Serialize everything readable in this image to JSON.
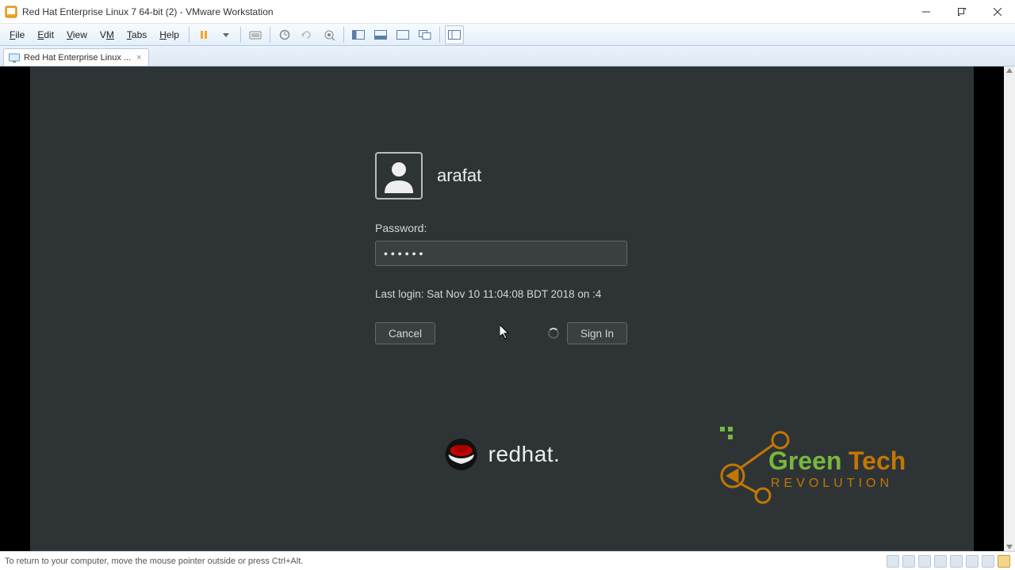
{
  "window": {
    "title": "Red Hat Enterprise Linux 7 64-bit (2) - VMware Workstation"
  },
  "menu": {
    "file": "File",
    "edit": "Edit",
    "view": "View",
    "vm": "VM",
    "tabs": "Tabs",
    "help": "Help"
  },
  "tab": {
    "label": "Red Hat Enterprise Linux ...",
    "close": "×"
  },
  "login": {
    "username": "arafat",
    "password_label": "Password:",
    "password_value": "••••••",
    "last_login": "Last login: Sat Nov 10 11:04:08 BDT 2018 on :4",
    "cancel_label": "Cancel",
    "signin_label": "Sign In"
  },
  "brand": {
    "redhat": "redhat."
  },
  "status": {
    "hint": "To return to your computer, move the mouse pointer outside or press Ctrl+Alt."
  },
  "watermark": {
    "line1": "GreenTech",
    "line2": "REVOLUTION"
  }
}
